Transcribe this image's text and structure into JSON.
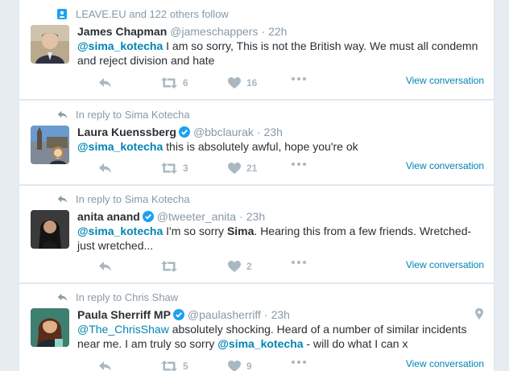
{
  "tweets": [
    {
      "context": "LEAVE.EU and 122 others follow",
      "name": "James Chapman",
      "handle": "@jameschappers",
      "time": "22h",
      "mention1": "@sima_kotecha",
      "text1": " I am so sorry, This is not the British way. We must all condemn and reject division and hate",
      "retweets": "6",
      "likes": "16",
      "view": "View conversation"
    },
    {
      "context": "In reply to Sima Kotecha",
      "name": "Laura Kuenssberg",
      "handle": "@bbclaurak",
      "time": "23h",
      "mention1": "@sima_kotecha",
      "text1": " this is absolutely awful, hope you're ok",
      "retweets": "3",
      "likes": "21",
      "view": "View conversation"
    },
    {
      "context": "In reply to Sima Kotecha",
      "name": "anita anand",
      "handle": "@tweeter_anita",
      "time": "23h",
      "mention1": "@sima_kotecha",
      "text1": " I'm so sorry ",
      "bold1": "Sima",
      "text2": ". Hearing this from a few friends. Wretched- just wretched...",
      "retweets": "",
      "likes": "2",
      "view": "View conversation"
    },
    {
      "context": "In reply to Chris Shaw",
      "name": "Paula Sherriff MP",
      "handle": "@paulasherriff",
      "time": "23h",
      "mention1": "@The_ChrisShaw",
      "text1": " absolutely shocking. Heard of a number of similar incidents near me. I am truly so sorry ",
      "mention2": "@sima_kotecha",
      "text2": " - will do what I can x",
      "retweets": "5",
      "likes": "9",
      "view": "View conversation"
    }
  ],
  "colors": {
    "link": "#0084b4",
    "muted": "#8899a6",
    "icon": "#aab8c2",
    "verified": "#1da1f2",
    "background": "#e6ecf0"
  },
  "icons": {
    "follow_context": "person-icon",
    "reply_context": "reply-arrow-icon",
    "reply": "reply-icon",
    "retweet": "retweet-icon",
    "like": "heart-icon",
    "more": "more-dots-icon",
    "verified": "verified-badge-icon",
    "location": "location-pin-icon"
  }
}
